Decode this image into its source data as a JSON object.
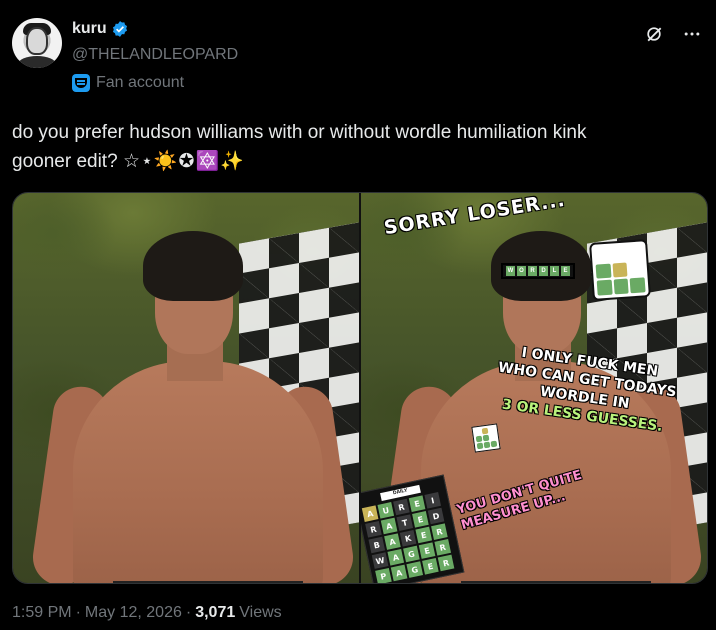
{
  "author": {
    "display_name": "kuru",
    "handle": "@THELANDLEOPARD",
    "affiliation_label": "Fan account"
  },
  "tweet": {
    "text_main": "do you prefer hudson williams with or without wordle humiliation kink",
    "text_line2": "gooner edit?",
    "text_deco": "☆⋆☀️✪🔯✨"
  },
  "media_right": {
    "sticker_top": "SORRY LOSER...",
    "sticker_middle_1": "I ONLY FUCK MEN",
    "sticker_middle_2": "WHO CAN GET TODAYS",
    "sticker_middle_3": "WORDLE IN",
    "sticker_middle_4": "3 OR LESS GUESSES.",
    "sticker_bottom_1": "YOU DON'T QUITE",
    "sticker_bottom_2": "MEASURE UP...",
    "wordle_bar_letters": [
      "W",
      "O",
      "R",
      "D",
      "L",
      "E"
    ],
    "board_header": "DAILY",
    "board_rows": [
      [
        "A",
        "U",
        "R",
        "E",
        "I"
      ],
      [
        "R",
        "A",
        "T",
        "E",
        "D"
      ],
      [
        "B",
        "A",
        "K",
        "E",
        "R"
      ],
      [
        "W",
        "A",
        "G",
        "E",
        "R"
      ],
      [
        "P",
        "A",
        "G",
        "E",
        "R"
      ]
    ]
  },
  "meta": {
    "time": "1:59 PM",
    "date": "May 12, 2026",
    "views_count": "3,071",
    "views_label": "Views"
  },
  "colors": {
    "background": "#000000",
    "accent_blue": "#1d9bf0",
    "wordle_green": "#6aaa64",
    "wordle_yellow": "#c9b458",
    "muted_text": "#71767b"
  },
  "icons": {
    "verified": "verified-badge-icon",
    "grok": "grok-icon",
    "more": "more-dots-icon",
    "fan": "fan-mask-icon"
  }
}
